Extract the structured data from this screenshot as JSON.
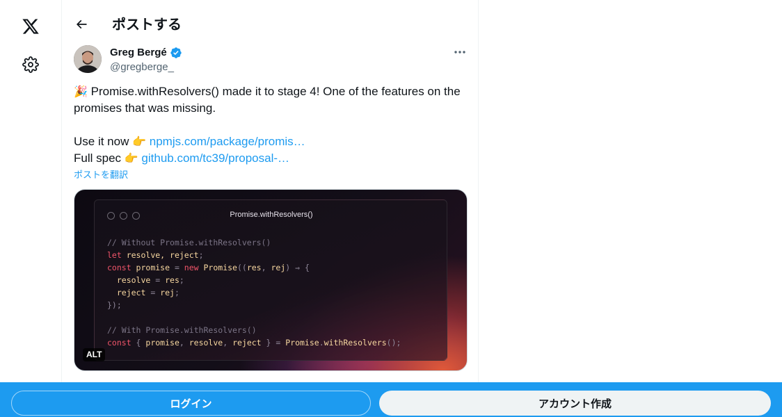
{
  "header": {
    "title": "ポストする"
  },
  "tweet": {
    "author_name": "Greg Bergé",
    "author_handle": "@gregberge_",
    "text_line1": "Promise.withResolvers() made it to stage 4! One of the features on the",
    "text_line2": "promises that was missing.",
    "use_label": "Use it now ",
    "use_link": "npmjs.com/package/promis…",
    "spec_label": "Full spec ",
    "spec_link": "github.com/tc39/proposal-…",
    "translate": "ポストを翻訳",
    "emoji_party": "🎉",
    "emoji_point": "👉"
  },
  "media": {
    "window_title": "Promise.withResolvers()",
    "alt_badge": "ALT",
    "code": [
      [
        {
          "t": "// Without Promise.withResolvers()",
          "c": "cm"
        }
      ],
      [
        {
          "t": "let",
          "c": "kw"
        },
        {
          "t": " resolve, reject",
          "c": "fn"
        },
        {
          "t": ";",
          "c": "pn"
        }
      ],
      [
        {
          "t": "const",
          "c": "kw"
        },
        {
          "t": " promise ",
          "c": "fn"
        },
        {
          "t": "= ",
          "c": "pn"
        },
        {
          "t": "new",
          "c": "kw"
        },
        {
          "t": " Promise",
          "c": "fn"
        },
        {
          "t": "((",
          "c": "pn"
        },
        {
          "t": "res",
          "c": "fn"
        },
        {
          "t": ", ",
          "c": "pn"
        },
        {
          "t": "rej",
          "c": "fn"
        },
        {
          "t": ") ⇒ {",
          "c": "pn"
        }
      ],
      [
        {
          "t": "  resolve ",
          "c": "fn"
        },
        {
          "t": "= ",
          "c": "pn"
        },
        {
          "t": "res",
          "c": "fn"
        },
        {
          "t": ";",
          "c": "pn"
        }
      ],
      [
        {
          "t": "  reject ",
          "c": "fn"
        },
        {
          "t": "= ",
          "c": "pn"
        },
        {
          "t": "rej",
          "c": "fn"
        },
        {
          "t": ";",
          "c": "pn"
        }
      ],
      [
        {
          "t": "});",
          "c": "pn"
        }
      ],
      [
        {
          "t": "",
          "c": "pn"
        }
      ],
      [
        {
          "t": "// With Promise.withResolvers()",
          "c": "cm"
        }
      ],
      [
        {
          "t": "const",
          "c": "kw"
        },
        {
          "t": " { ",
          "c": "pn"
        },
        {
          "t": "promise",
          "c": "fn"
        },
        {
          "t": ", ",
          "c": "pn"
        },
        {
          "t": "resolve",
          "c": "fn"
        },
        {
          "t": ", ",
          "c": "pn"
        },
        {
          "t": "reject",
          "c": "fn"
        },
        {
          "t": " } = ",
          "c": "pn"
        },
        {
          "t": "Promise",
          "c": "fn"
        },
        {
          "t": ".",
          "c": "pn"
        },
        {
          "t": "withResolvers",
          "c": "fn"
        },
        {
          "t": "();",
          "c": "pn"
        }
      ]
    ]
  },
  "bottom_bar": {
    "login_label": "ログイン",
    "signup_label": "アカウント作成"
  },
  "colors": {
    "accent": "#1d9bf0",
    "verified": "#1d9bf0",
    "text": "#0f1419",
    "secondary": "#536471"
  },
  "icons": {
    "logo": "x-logo-icon",
    "settings": "gear-icon",
    "back": "back-arrow-icon",
    "verified": "verified-badge-icon",
    "more": "more-dots-icon"
  }
}
